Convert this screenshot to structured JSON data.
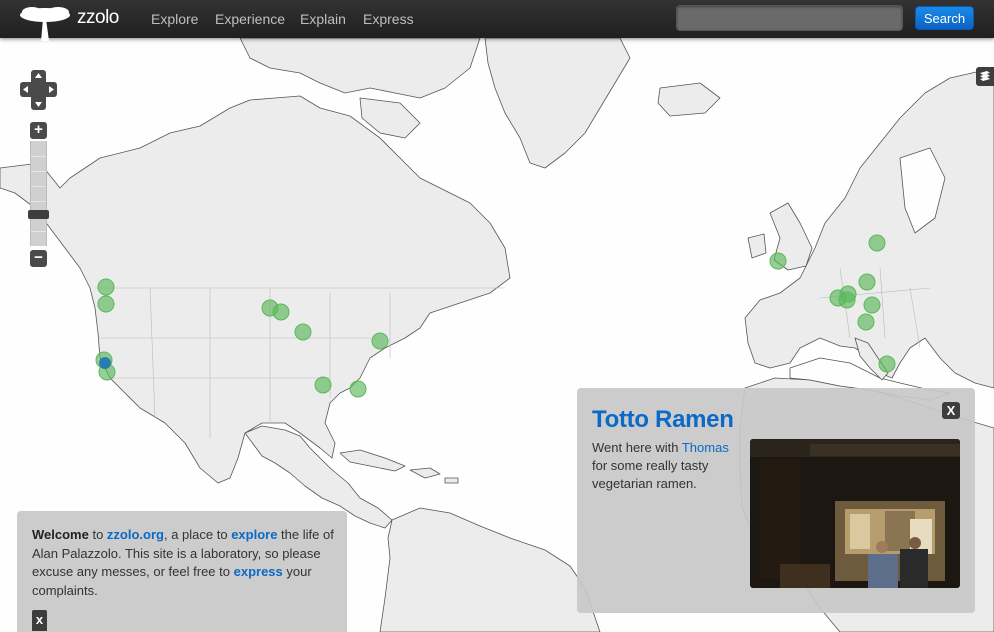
{
  "header": {
    "brand": "zzolo",
    "nav": [
      "Explore",
      "Experience",
      "Explain",
      "Express"
    ],
    "search_value": "",
    "search_button": "Search"
  },
  "popup": {
    "title": "Totto Ramen",
    "text_before": "Went here with ",
    "link": "Thomas",
    "text_after": " for some really tasty vegetarian ramen.",
    "close": "X"
  },
  "welcome": {
    "welcome_word": "Welcome",
    "t1": " to ",
    "site_link": "zzolo.org",
    "t2": ", a place to ",
    "explore_link": "explore",
    "t3": " the life of Alan Palazzolo. This site is a laboratory, so please excuse any messes, or feel free to ",
    "express_link": "express",
    "t4": " your complaints.",
    "close": "x"
  },
  "map": {
    "marker_color": "#5cb85c",
    "selected_marker_color": "#1f74b7"
  },
  "icons": {
    "pan": "pan-control-icon",
    "zoom_in": "zoom-in-icon",
    "zoom_out": "zoom-out-icon",
    "layers": "layers-icon",
    "logo": "tree-logo-icon"
  }
}
